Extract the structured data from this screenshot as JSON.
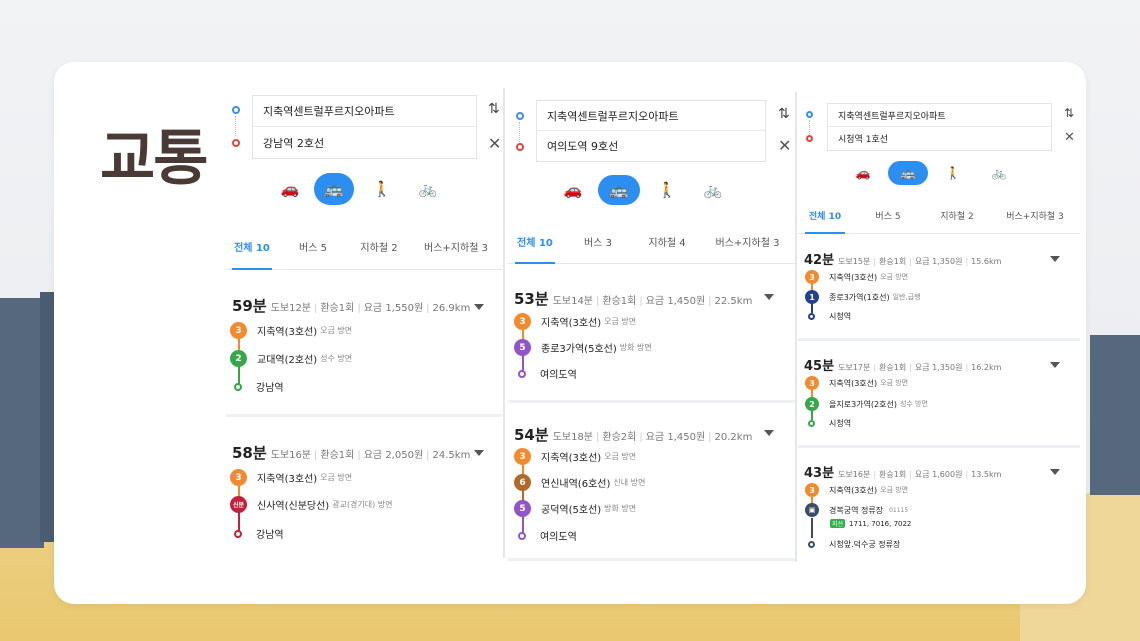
{
  "title": "교통",
  "colors": {
    "accent": "#2b8ef0",
    "line2": "#36a74a",
    "line3": "#f28a2e",
    "line1": "#25408f",
    "line5": "#9254c6",
    "line6": "#b06a2a",
    "line9": "#b89454",
    "shinbundang": "#c0223a",
    "bus": "#3b4c6b"
  },
  "icons": {
    "car": "car-icon",
    "bus": "bus-icon",
    "walk": "walk-icon",
    "bike": "bike-icon",
    "swap": "swap-icon",
    "close": "close-icon",
    "expand": "caret-down-icon"
  },
  "panels": [
    {
      "origin": "지축역센트럴푸르지오아파트",
      "destination": "강남역 2호선",
      "tabs": [
        "전체 10",
        "버스 5",
        "지하철 2",
        "버스+지하철 3"
      ],
      "routes": [
        {
          "time": "59분",
          "walk": "도보12분",
          "transfer": "환승1회",
          "fare": "요금 1,550원",
          "distance": "26.9km",
          "stops": [
            {
              "badge": "3",
              "name": "지축역(3호선)",
              "dir": "오금 방면"
            },
            {
              "badge": "2",
              "name": "교대역(2호선)",
              "dir": "성수 방면"
            },
            {
              "badge": "",
              "name": "강남역",
              "dir": ""
            }
          ]
        },
        {
          "time": "58분",
          "walk": "도보16분",
          "transfer": "환승1회",
          "fare": "요금 2,050원",
          "distance": "24.5km",
          "stops": [
            {
              "badge": "3",
              "name": "지축역(3호선)",
              "dir": "오금 방면"
            },
            {
              "badge": "신분",
              "name": "신사역(신분당선)",
              "dir": "광교(경기대) 방면"
            },
            {
              "badge": "",
              "name": "강남역",
              "dir": ""
            }
          ]
        }
      ]
    },
    {
      "origin": "지축역센트럴푸르지오아파트",
      "destination": "여의도역 9호선",
      "tabs": [
        "전체 10",
        "버스 3",
        "지하철 4",
        "버스+지하철 3"
      ],
      "routes": [
        {
          "time": "53분",
          "walk": "도보14분",
          "transfer": "환승1회",
          "fare": "요금 1,450원",
          "distance": "22.5km",
          "stops": [
            {
              "badge": "3",
              "name": "지축역(3호선)",
              "dir": "오금 방면"
            },
            {
              "badge": "5",
              "name": "종로3가역(5호선)",
              "dir": "방화 방면"
            },
            {
              "badge": "",
              "name": "여의도역",
              "dir": ""
            }
          ]
        },
        {
          "time": "54분",
          "walk": "도보18분",
          "transfer": "환승2회",
          "fare": "요금 1,450원",
          "distance": "20.2km",
          "stops": [
            {
              "badge": "3",
              "name": "지축역(3호선)",
              "dir": "오금 방면"
            },
            {
              "badge": "6",
              "name": "연신내역(6호선)",
              "dir": "신내 방면"
            },
            {
              "badge": "5",
              "name": "공덕역(5호선)",
              "dir": "방화 방면"
            },
            {
              "badge": "",
              "name": "여의도역",
              "dir": ""
            }
          ]
        }
      ]
    },
    {
      "origin": "지축역센트럴푸르지오아파트",
      "destination": "시청역 1호선",
      "tabs": [
        "전체 10",
        "버스 5",
        "지하철 2",
        "버스+지하철 3"
      ],
      "routes": [
        {
          "time": "42분",
          "walk": "도보15분",
          "transfer": "환승1회",
          "fare": "요금 1,350원",
          "distance": "15.6km",
          "stops": [
            {
              "badge": "3",
              "name": "지축역(3호선)",
              "dir": "오금 방면"
            },
            {
              "badge": "1",
              "name": "종로3가역(1호선)",
              "dir": "일반,급행"
            },
            {
              "badge": "",
              "name": "시청역",
              "dir": ""
            }
          ]
        },
        {
          "time": "45분",
          "walk": "도보17분",
          "transfer": "환승1회",
          "fare": "요금 1,350원",
          "distance": "16.2km",
          "stops": [
            {
              "badge": "3",
              "name": "지축역(3호선)",
              "dir": "오금 방면"
            },
            {
              "badge": "2",
              "name": "을지로3가역(2호선)",
              "dir": "성수 방면"
            },
            {
              "badge": "",
              "name": "시청역",
              "dir": ""
            }
          ]
        },
        {
          "time": "43분",
          "walk": "도보16분",
          "transfer": "환승1회",
          "fare": "요금 1,600원",
          "distance": "13.5km",
          "stops": [
            {
              "badge": "3",
              "name": "지축역(3호선)",
              "dir": "오금 방면"
            },
            {
              "badge": "bus",
              "name": "경복궁역 정류장",
              "dir": "01115",
              "buses_label": "지선",
              "buses": "1711, 7016, 7022"
            },
            {
              "badge": "",
              "name": "시청앞.덕수궁 정류장",
              "dir": ""
            }
          ]
        }
      ]
    }
  ]
}
